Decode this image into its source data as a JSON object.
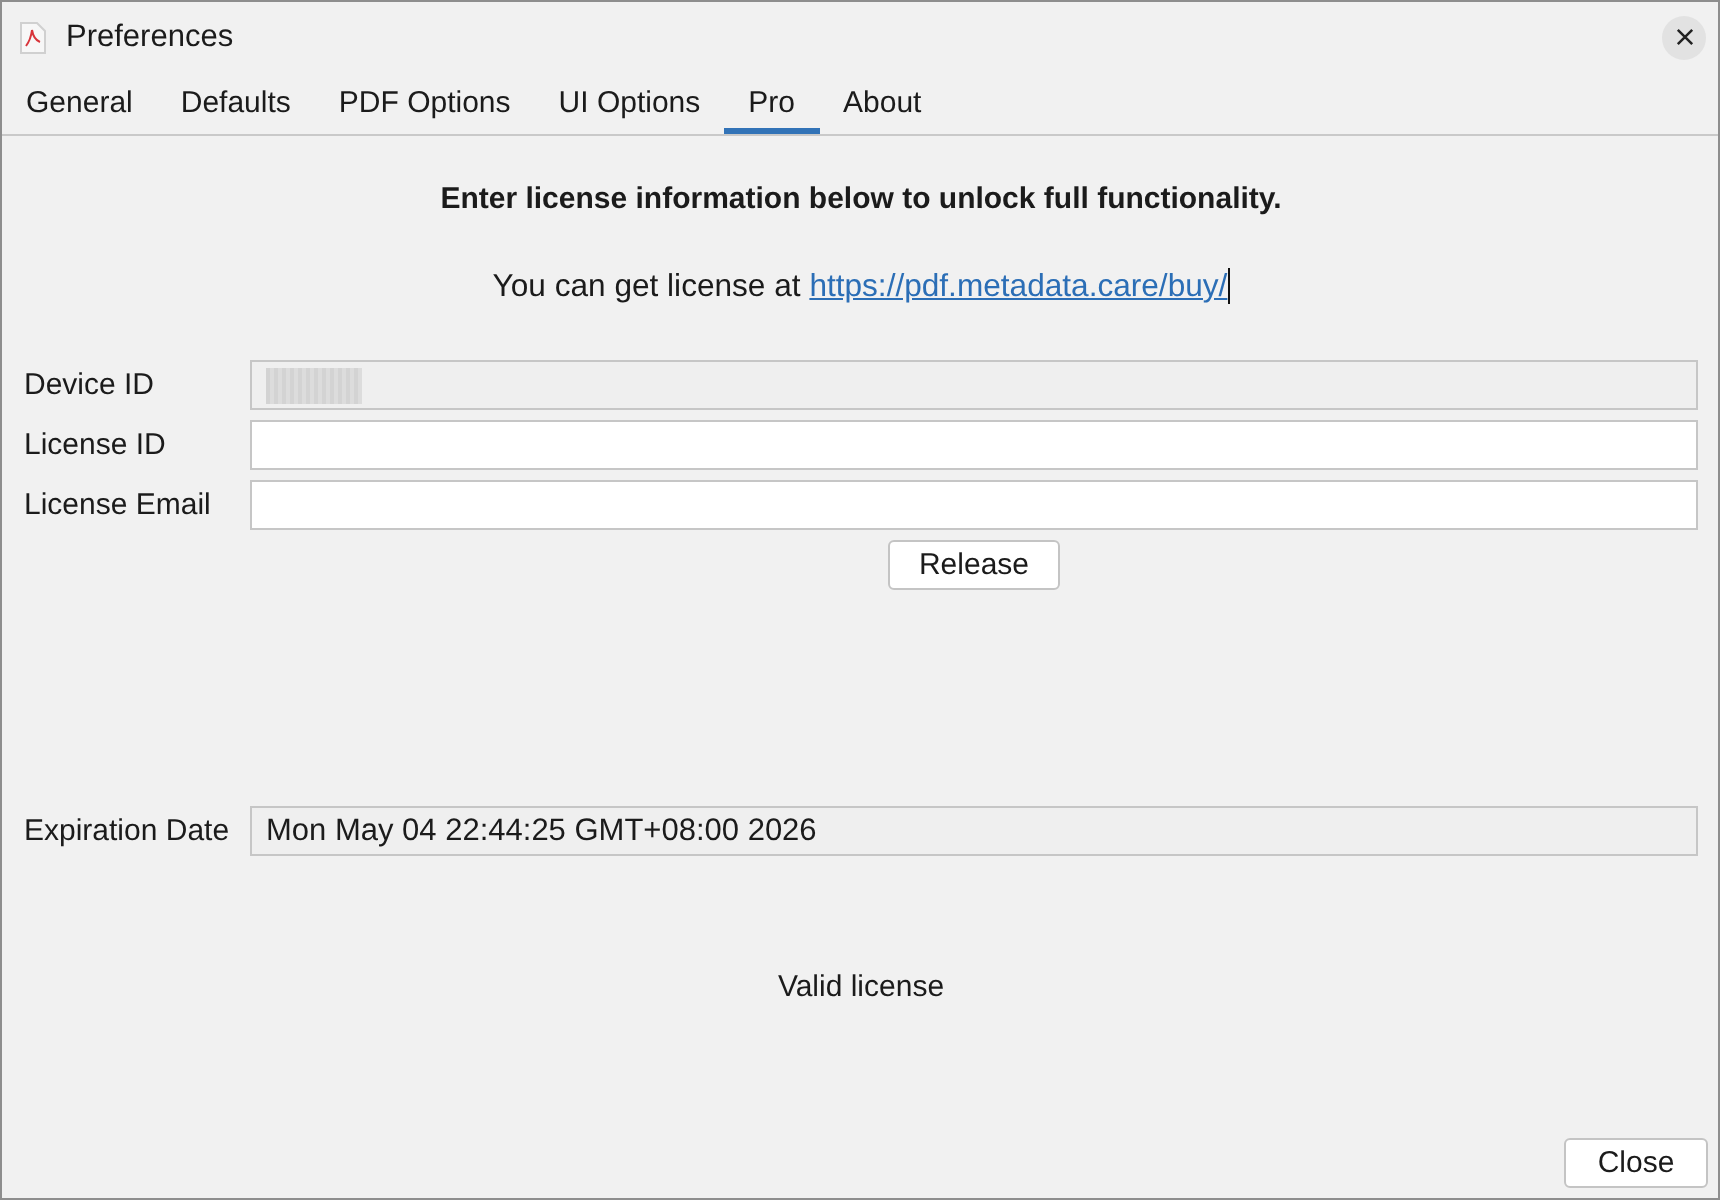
{
  "window": {
    "title": "Preferences"
  },
  "tabs": [
    {
      "label": "General",
      "selected": false
    },
    {
      "label": "Defaults",
      "selected": false
    },
    {
      "label": "PDF Options",
      "selected": false
    },
    {
      "label": "UI Options",
      "selected": false
    },
    {
      "label": "Pro",
      "selected": true
    },
    {
      "label": "About",
      "selected": false
    }
  ],
  "pro": {
    "heading": "Enter license information below to unlock full functionality.",
    "hint": "You can get license at",
    "link": "https://pdf.metadata.care/buy/",
    "link_caret": true,
    "fields": [
      {
        "label": "Device ID",
        "disabled": true,
        "value_hidden": true
      },
      {
        "label": "License ID",
        "disabled": false,
        "value_hidden": false
      },
      {
        "label": "License Email",
        "disabled": false,
        "value_hidden": false
      }
    ],
    "release_button": "Release",
    "expiration": {
      "label": "Expiration Date",
      "value": "Mon May 04 22:44:25 GMT+08:00 2026",
      "disabled": true
    },
    "status": "Valid license"
  },
  "buttons": [
    "Close"
  ]
}
